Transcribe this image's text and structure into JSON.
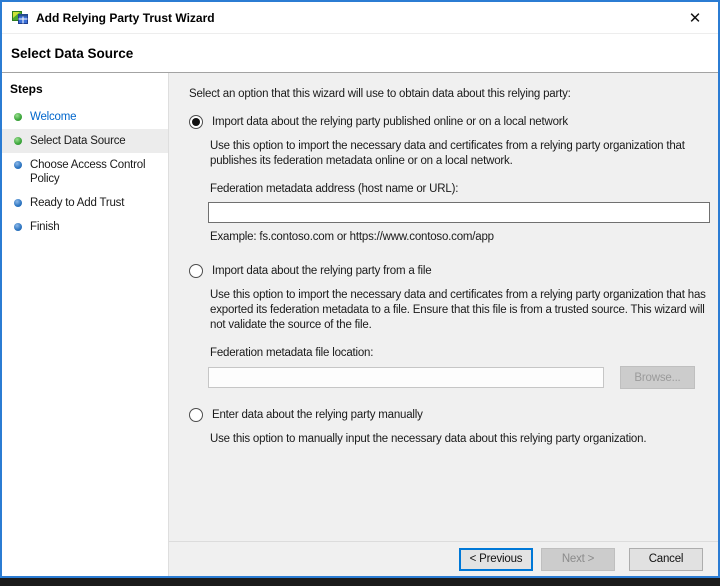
{
  "window": {
    "title": "Add Relying Party Trust Wizard",
    "close": "✕"
  },
  "page": {
    "heading": "Select Data Source"
  },
  "sidebar": {
    "title": "Steps",
    "items": [
      {
        "label": "Welcome",
        "status": "completed"
      },
      {
        "label": "Select Data Source",
        "status": "current"
      },
      {
        "label": "Choose Access Control Policy",
        "status": "upcoming"
      },
      {
        "label": "Ready to Add Trust",
        "status": "upcoming"
      },
      {
        "label": "Finish",
        "status": "upcoming"
      }
    ]
  },
  "content": {
    "intro": "Select an option that this wizard will use to obtain data about this relying party:",
    "options": [
      {
        "label": "Import data about the relying party published online or on a local network",
        "selected": true,
        "description": "Use this option to import the necessary data and certificates from a relying party organization that publishes its federation metadata online or on a local network.",
        "field_label": "Federation metadata address (host name or URL):",
        "field_value": "",
        "example": "Example: fs.contoso.com or https://www.contoso.com/app"
      },
      {
        "label": "Import data about the relying party from a file",
        "selected": false,
        "description": "Use this option to import the necessary data and certificates from a relying party organization that has exported its federation metadata to a file. Ensure that this file is from a trusted source.  This wizard will not validate the source of the file.",
        "field_label": "Federation metadata file location:",
        "field_value": "",
        "browse_label": "Browse..."
      },
      {
        "label": "Enter data about the relying party manually",
        "selected": false,
        "description": "Use this option to manually input the necessary data about this relying party organization."
      }
    ]
  },
  "footer": {
    "previous": "< Previous",
    "next": "Next >",
    "cancel": "Cancel"
  },
  "colors": {
    "window_border": "#2b7cd3",
    "content_bg": "#f0f0f0",
    "step_link": "#0066cc",
    "bullet_completed": "#3aa53a",
    "bullet_upcoming": "#2b74c0",
    "focus_border": "#0078d7",
    "disabled_text": "#8b8b8b"
  }
}
